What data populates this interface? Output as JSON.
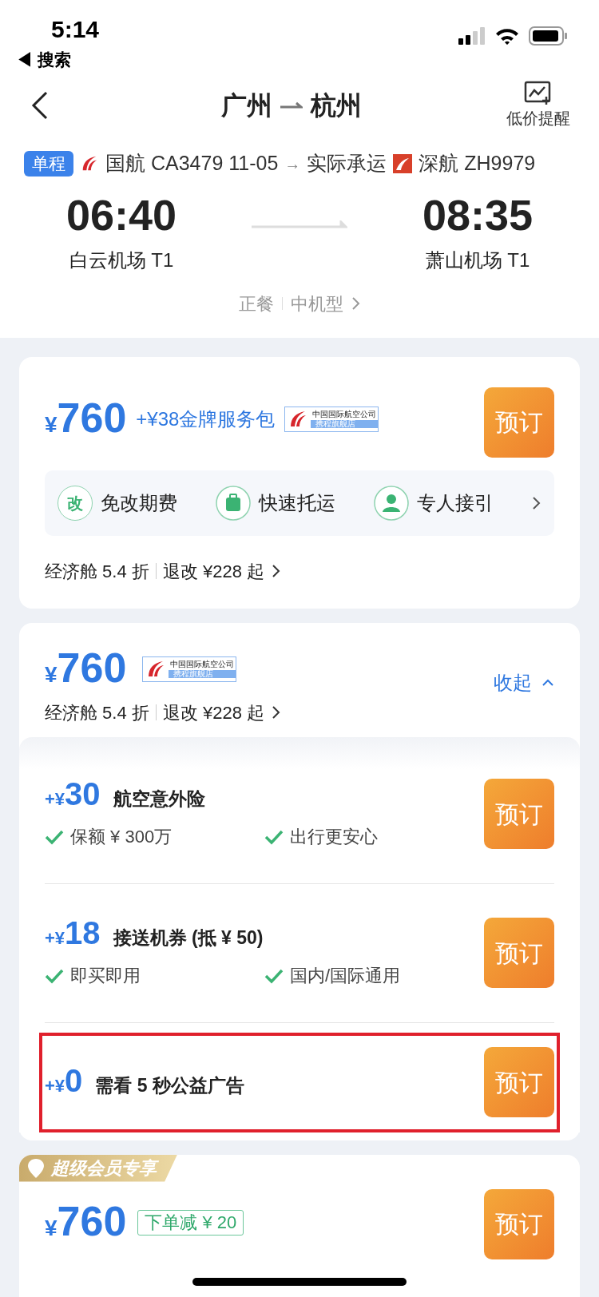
{
  "status_bar": {
    "time": "5:14",
    "back_app": "◀ 搜索"
  },
  "nav": {
    "from": "广州",
    "to": "杭州",
    "alert_label": "低价提醒"
  },
  "flight": {
    "trip_type": "单程",
    "operator": "国航 CA3479 11-05",
    "arrow": "→",
    "actual_carrier_label": "实际承运",
    "carrier": "深航 ZH9979",
    "depart_time": "06:40",
    "depart_airport": "白云机场 T1",
    "arrive_time": "08:35",
    "arrive_airport": "萧山机场 T1",
    "meal": "正餐",
    "aircraft": "中机型"
  },
  "offers": [
    {
      "kind": "package",
      "price_symbol": "¥",
      "price": "760",
      "extra": "+¥38金牌服务包",
      "store_badge": {
        "line1": "中国国际航空公司",
        "line2": "携程旗舰店"
      },
      "button": "预订",
      "features": [
        {
          "kind": "glyph",
          "glyph": "改",
          "label": "免改期费"
        },
        {
          "kind": "luggage",
          "label": "快速托运"
        },
        {
          "kind": "person",
          "label": "专人接引"
        }
      ],
      "cabin": "经济舱 5.4 折",
      "refund": "退改 ¥228 起"
    },
    {
      "kind": "expanded",
      "price_symbol": "¥",
      "price": "760",
      "store_badge": {
        "line1": "中国国际航空公司",
        "line2": "携程旗舰店"
      },
      "collapse": "收起",
      "expanded": true,
      "cabin": "经济舱 5.4 折",
      "refund": "退改 ¥228 起",
      "addons": [
        {
          "prefix": "+¥",
          "price": "30",
          "title": "航空意外险",
          "checks": [
            "保额 ¥ 300万",
            "出行更安心"
          ],
          "button": "预订",
          "highlighted": false
        },
        {
          "prefix": "+¥",
          "price": "18",
          "title": "接送机券 (抵 ¥ 50)",
          "checks": [
            "即买即用",
            "国内/国际通用"
          ],
          "button": "预订",
          "highlighted": false
        },
        {
          "prefix": "+¥",
          "price": "0",
          "title": "需看 5 秒公益广告",
          "button": "预订",
          "highlighted": true
        }
      ]
    },
    {
      "kind": "member",
      "tag": "超级会员专享",
      "price_symbol": "¥",
      "price": "760",
      "discount": "下单减 ¥ 20",
      "button": "预订"
    }
  ]
}
